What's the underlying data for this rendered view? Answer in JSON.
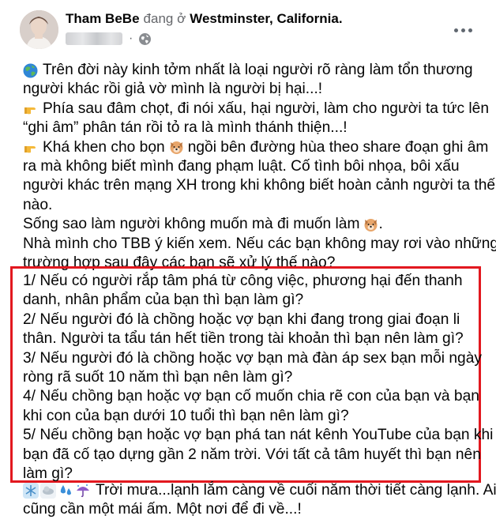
{
  "header": {
    "author": "Tham BeBe",
    "verb": "đang ở",
    "location": "Westminster, California."
  },
  "icons": {
    "globe": "globe-emoji-icon",
    "point": "backhand-index-pointing-right-icon",
    "dog": "dog-face-icon",
    "audience": "globe-audience-icon",
    "more": "more-options-icon",
    "weather": [
      "snowflake-icon",
      "cloud-icon",
      "droplets-icon",
      "umbrella-rain-icon"
    ]
  },
  "colors": {
    "highlight_border": "#e2181f",
    "secondary_text": "#65676b"
  },
  "post": {
    "lines": [
      {
        "icon": "globe",
        "text": "Trên đời này kinh tởm nhất là loại người rõ ràng làm tổn thương"
      },
      {
        "text": "người khác rồi giả vờ mình là người bị hại...!"
      },
      {
        "icon": "point",
        "text": "Phía sau đâm chọt, đi nói xấu, hại người, làm cho người ta tức lên"
      },
      {
        "text": "“ghi âm” phân tán rồi tỏ ra là mình thánh thiện...!"
      },
      {
        "icon": "point",
        "text": "Khá khen cho bọn",
        "inline_icon": "dog",
        "text2": "ngồi bên đường hùa theo share đoạn ghi âm"
      },
      {
        "text": "ra mà không biết mình đang phạm luật. Cố tình bôi nhọa, bôi xấu"
      },
      {
        "text": "người khác trên mạng XH trong khi không biết hoàn cảnh người ta thế"
      },
      {
        "text": "nào."
      },
      {
        "text": "Sống sao làm người không muốn mà đi muốn làm",
        "inline_icon": "dog",
        "text2": "."
      },
      {
        "text": "Nhà mình cho TBB ý kiến xem. Nếu các bạn không may rơi vào những"
      },
      {
        "text": "trường hợp sau đây các bạn sẽ xử lý thế nào?"
      }
    ],
    "questions": [
      "1/ Nếu có người rắp tâm phá từ công việc, phương hại đến thanh",
      "danh, nhân phẩm của bạn thì bạn làm gì?",
      "2/ Nếu người đó là chồng hoặc vợ bạn khi đang trong giai đoạn li",
      "thân. Người ta tẩu tán hết tiền trong tài khoản thì bạn nên làm gì?",
      "3/ Nếu người đó là chồng hoặc vợ bạn mà đàn áp sex bạn mỗi ngày",
      "ròng rã suốt 10 năm thì bạn nên làm gì?",
      "4/ Nếu chồng bạn hoặc vợ bạn cố muốn chia rẽ con của bạn và bạn",
      "khi con của bạn dưới 10 tuổi thì bạn nên làm gì?",
      "5/ Nếu chồng bạn hoặc vợ bạn phá tan nát kênh YouTube của bạn khi",
      "bạn đã cố tạo dựng gần 2 năm trời. Với tất cả tâm huyết thì bạn nên",
      "làm gì?"
    ],
    "tail": [
      "Trời mưa...lạnh lắm càng về cuối năm thời tiết càng lạnh. Ai",
      "cũng cần một mái ấm. Một nơi để đi về...!"
    ]
  }
}
